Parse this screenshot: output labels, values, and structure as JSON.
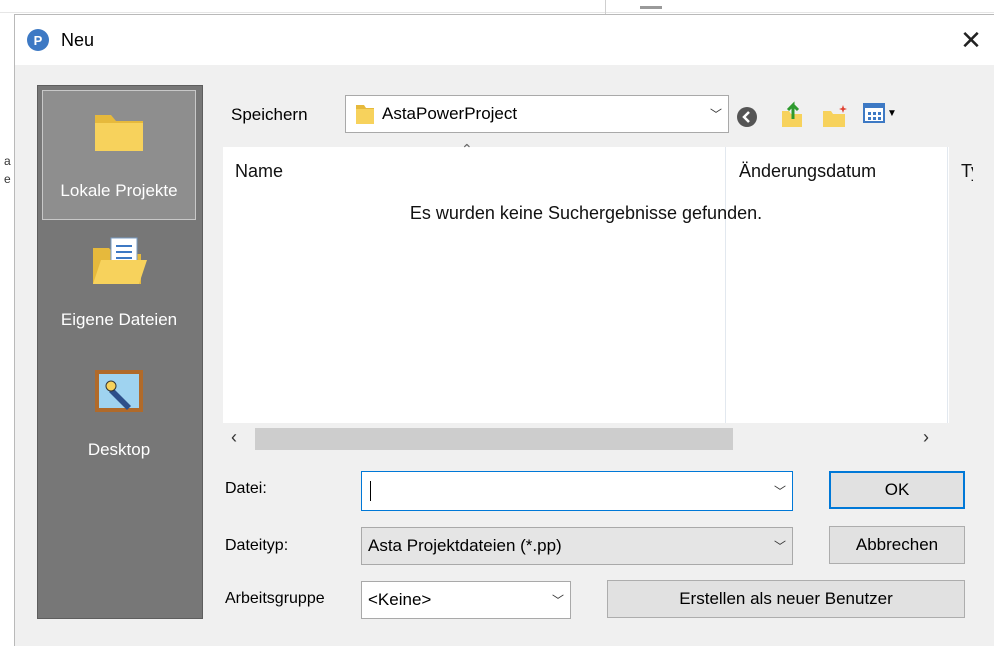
{
  "window": {
    "title": "Neu",
    "app_icon_letter": "P"
  },
  "background": {
    "frag_a": "a",
    "frag_e": "e"
  },
  "places": [
    {
      "label": "Lokale Projekte",
      "icon": "folder-icon"
    },
    {
      "label": "Eigene Dateien",
      "icon": "documents-folder-icon"
    },
    {
      "label": "Desktop",
      "icon": "desktop-icon"
    }
  ],
  "save_in": {
    "label": "Speichern",
    "value": "AstaPowerProject"
  },
  "toolbar": {
    "back": "back-icon",
    "up": "up-folder-icon",
    "new_folder": "new-folder-icon",
    "view": "view-menu-icon"
  },
  "file_list": {
    "columns": [
      "Name",
      "Änderungsdatum",
      "Ty"
    ],
    "empty_message": "Es wurden keine Suchergebnisse gefunden."
  },
  "fields": {
    "file_label": "Datei:",
    "file_value": "",
    "filetype_label": "Dateityp:",
    "filetype_value": "Asta Projektdateien (*.pp)",
    "workgroup_label": "Arbeitsgruppe",
    "workgroup_value": "<Keine>"
  },
  "buttons": {
    "ok": "OK",
    "cancel": "Abbrechen",
    "create_user": "Erstellen als neuer Benutzer"
  },
  "colors": {
    "accent": "#0078d7",
    "places_bg": "#777777",
    "folder": "#f7d25c"
  }
}
